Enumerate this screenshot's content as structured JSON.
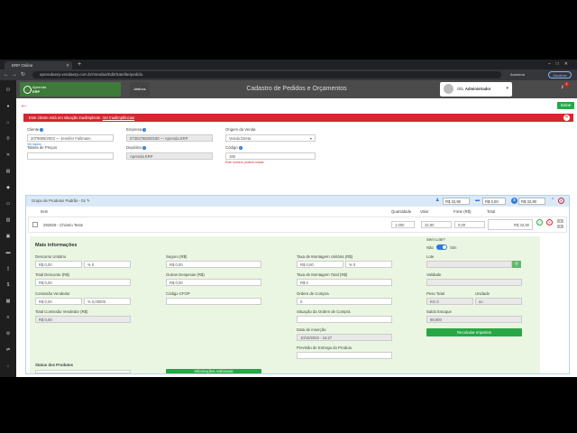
{
  "browser": {
    "tab_title": "ERP Online",
    "url": "aprendaerp.vendaerp.com.br/Vendas/Edit/Satelite/pedido",
    "profile": "Anônima",
    "update_label": "Atualizar"
  },
  "app": {
    "logo_line1": "Aprenda",
    "logo_line2": "ERP",
    "shortcuts": "Atalhos",
    "title": "Cadastro de Pedidos e Orçamentos",
    "user_line1": "Olá",
    "user_line2": "Administrador",
    "bell_count": "1"
  },
  "toolbar": {
    "save_label": "Salvar"
  },
  "alert": {
    "text": "Este cliente está em situação inadimplente.",
    "link": "Ver Inadimplências"
  },
  "form": {
    "cliente_label": "Cliente",
    "cliente_value": "2079696/2003 — Jennifer Fullmann",
    "ver_dados": "Ver dados",
    "empresa_label": "Empresa",
    "empresa_value": "07302756000190 — Aprenda ERP",
    "origem_label": "Origem da Venda",
    "origem_value": "Venda Direta",
    "tabela_label": "Tabela de Preços",
    "deposito_label": "Depósito",
    "deposito_value": "Aprenda ERP",
    "codigo_label": "Código",
    "codigo_value": "165",
    "codigo_hint": "Este número poderá mudar"
  },
  "group": {
    "title": "Grupo de Produtos Padrão - 01",
    "total1": "R$ 32,90",
    "total2": "R$ 0,00",
    "total3": "R$ 32,90",
    "col_item": "Item",
    "col_quantidade": "Quantidade",
    "col_valor": "Valor",
    "col_frete": "Frete (R$)",
    "col_total": "Total",
    "item_name": "292929 - Chinelo Teste",
    "item_qty": "1.000",
    "item_value": "32,90",
    "item_frete": "0,00",
    "item_total": "R$ 32,90"
  },
  "more": {
    "title": "Mais informações",
    "desc_unit_label": "Desconto Unitário",
    "desc_unit_value": "R$ 0,00",
    "desc_unit_pct": "% 0",
    "seguro_label": "Seguro (R$)",
    "seguro_value": "R$ 0,00",
    "taxa_unit_label": "Taxa de Montagem Unitária (R$)",
    "taxa_unit_value": "R$ 0,00",
    "taxa_unit_pct": "% 0",
    "sem_lote_label": "Sem Lote?",
    "nao": "Não",
    "sim": "Sim",
    "lote_label": "Lote",
    "desc_total_label": "Total Desconto (R$)",
    "desc_total_value": "R$ 0,00",
    "outras_label": "Outras Despesas (R$)",
    "outras_value": "R$ 0,00",
    "taxa_total_label": "Taxa de Montagem Total (R$)",
    "taxa_total_value": "R$ 0",
    "validade_label": "Validade",
    "comissao_label": "Comissão Vendedor",
    "comissao_value": "R$ 0,00",
    "comissao_pct": "% 0,00000",
    "cfop_label": "Código CFOP",
    "ordem_label": "Ordem de Compra",
    "ordem_value": "0",
    "peso_label": "Peso Total",
    "peso_value": "KG 0",
    "unidade_label": "Unidade",
    "unidade_value": "un",
    "comissao_total_label": "Total Comissão Vendedor (R$)",
    "comissao_total_value": "R$ 0,00",
    "situacao_label": "Situação da Ordem de Compra",
    "saldo_label": "Saldo Estoque",
    "saldo_value": "98,000",
    "data_label": "Data de inserção",
    "data_value": "10/10/2022 - 15:27",
    "recalcular": "Recalcular Impostos",
    "previsao_label": "Previsão de Entrega do Produto",
    "status_label": "Status dos Produtos",
    "info_adicionais": "Informações Adicionais"
  }
}
